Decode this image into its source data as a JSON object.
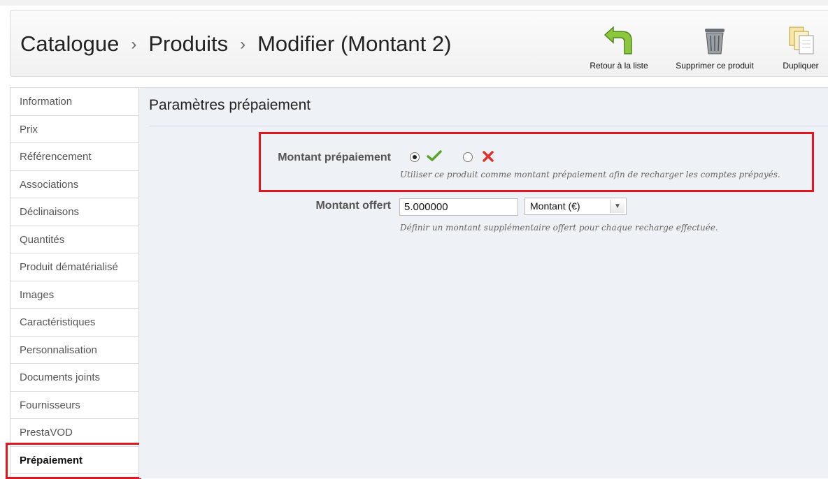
{
  "header": {
    "breadcrumb": [
      "Catalogue",
      "Produits",
      "Modifier (Montant 2)"
    ],
    "separator": "›",
    "actions": {
      "back_label": "Retour à la liste",
      "delete_label": "Supprimer ce produit",
      "duplicate_label": "Dupliquer"
    }
  },
  "sidebar": {
    "items": [
      "Information",
      "Prix",
      "Référencement",
      "Associations",
      "Déclinaisons",
      "Quantités",
      "Produit dématérialisé",
      "Images",
      "Caractéristiques",
      "Personnalisation",
      "Documents joints",
      "Fournisseurs",
      "PrestaVOD",
      "Prépaiement"
    ],
    "active": "Prépaiement"
  },
  "main": {
    "section_title": "Paramètres prépaiement",
    "prepay": {
      "label": "Montant prépaiement",
      "selected": "yes",
      "hint": "Utiliser ce produit comme montant prépaiement afin de recharger les comptes prépayés."
    },
    "offer": {
      "label": "Montant offert",
      "value": "5.000000",
      "unit_selected": "Montant (€)",
      "hint": "Définir un montant supplémentaire offert pour chaque recharge effectuée."
    }
  },
  "colors": {
    "highlight": "#e2161f",
    "check": "#5aa52b",
    "cross": "#e03030",
    "panel_bg": "#eef1f6"
  },
  "icons": [
    "return-arrow-icon",
    "trash-icon",
    "duplicate-icon",
    "check-icon",
    "cross-icon",
    "chevron-down-icon"
  ]
}
